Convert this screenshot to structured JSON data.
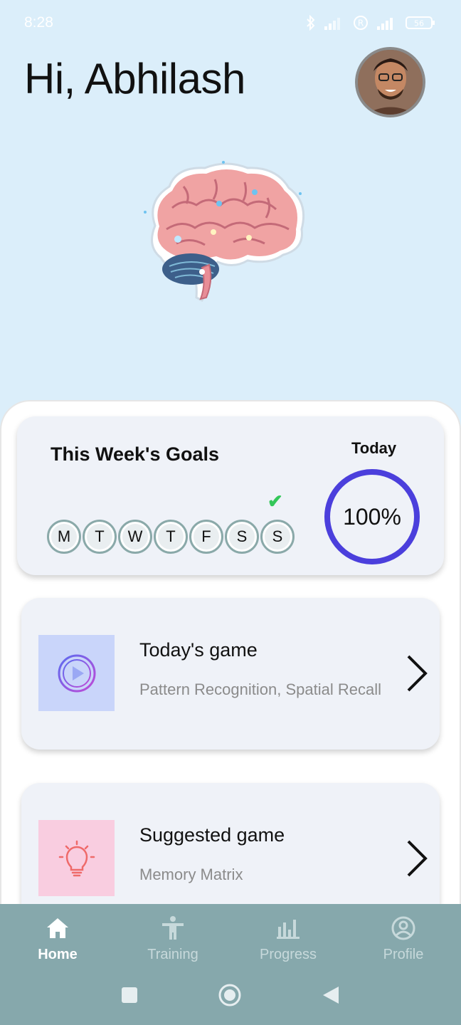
{
  "status": {
    "time": "8:28",
    "battery": "56"
  },
  "greeting": "Hi, Abhilash",
  "goals": {
    "title": "This Week's Goals",
    "today_label": "Today",
    "progress_percent": 100,
    "progress_text": "100%",
    "days": [
      "M",
      "T",
      "W",
      "T",
      "F",
      "S",
      "S"
    ],
    "completed_day_index": 6,
    "check_mark": "✔"
  },
  "games": [
    {
      "title": "Today's game",
      "subtitle": "Pattern Recognition, Spatial Recall",
      "icon": "play-circle-icon"
    },
    {
      "title": "Suggested game",
      "subtitle": "Memory Matrix",
      "icon": "lightbulb-icon"
    }
  ],
  "nav": [
    {
      "label": "Home",
      "icon": "home-icon",
      "active": true
    },
    {
      "label": "Training",
      "icon": "person-icon",
      "active": false
    },
    {
      "label": "Progress",
      "icon": "bar-chart-icon",
      "active": false
    },
    {
      "label": "Profile",
      "icon": "account-circle-icon",
      "active": false
    }
  ],
  "colors": {
    "header_bg": "#dbeefa",
    "ring": "#4b3fdc",
    "nav_bg": "#86a8ac",
    "check": "#34c759",
    "thumb_blue": "#c9d5fa",
    "thumb_pink": "#f9cde0"
  }
}
